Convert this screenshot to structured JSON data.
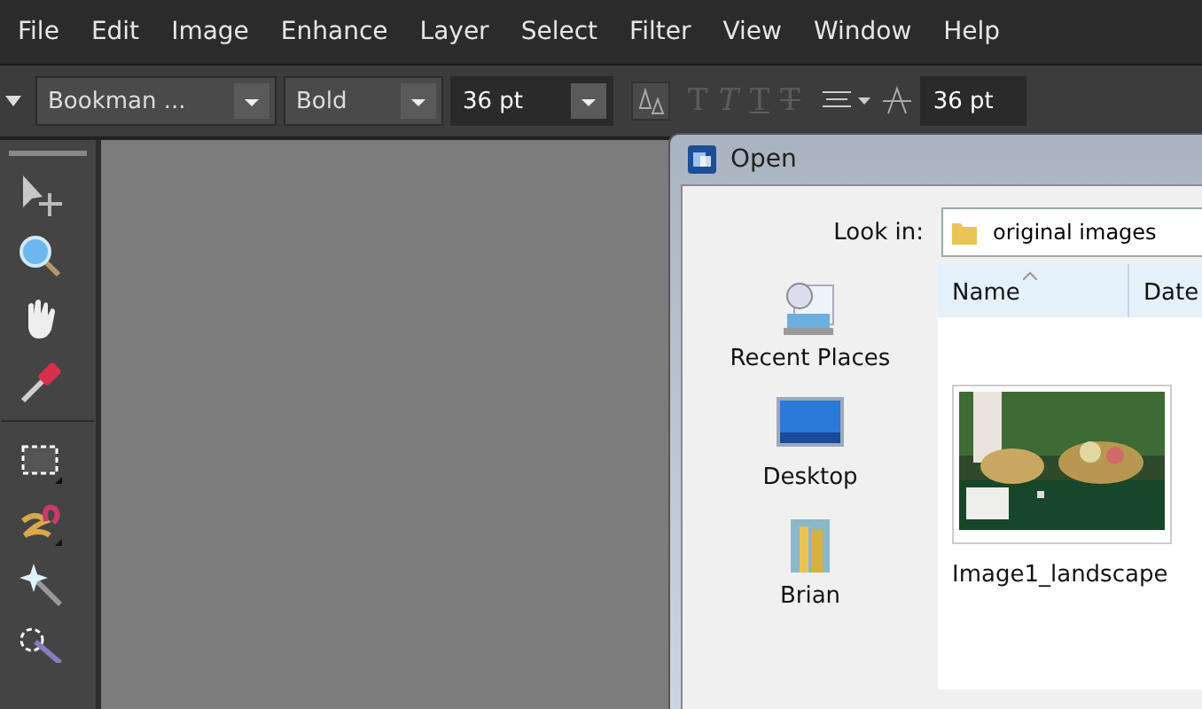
{
  "menu": [
    "File",
    "Edit",
    "Image",
    "Enhance",
    "Layer",
    "Select",
    "Filter",
    "View",
    "Window",
    "Help"
  ],
  "options_bar": {
    "font": "Bookman ...",
    "style": "Bold",
    "size": "36 pt",
    "text_styles": [
      {
        "label": "T",
        "disabled": true
      },
      {
        "label": "T",
        "disabled": true
      },
      {
        "label": "T",
        "disabled": true
      },
      {
        "label": "T",
        "disabled": true
      }
    ],
    "leading": "36 pt"
  },
  "tools": [
    {
      "kind": "move"
    },
    {
      "kind": "zoom"
    },
    {
      "kind": "hand"
    },
    {
      "kind": "eyedropper"
    },
    {
      "kind": "marquee"
    },
    {
      "kind": "lasso"
    },
    {
      "kind": "wand"
    },
    {
      "kind": "quickselect"
    }
  ],
  "dialog": {
    "title": "Open",
    "look_in_label": "Look in:",
    "look_in": "original images",
    "places": [
      {
        "kind": "recent",
        "label": "Recent Places"
      },
      {
        "kind": "desktop",
        "label": "Desktop"
      },
      {
        "kind": "user",
        "label": "Brian"
      }
    ],
    "columns": [
      "Name",
      "Date"
    ],
    "files": [
      {
        "kind": "picture",
        "name": "Image1_landscape"
      }
    ]
  }
}
